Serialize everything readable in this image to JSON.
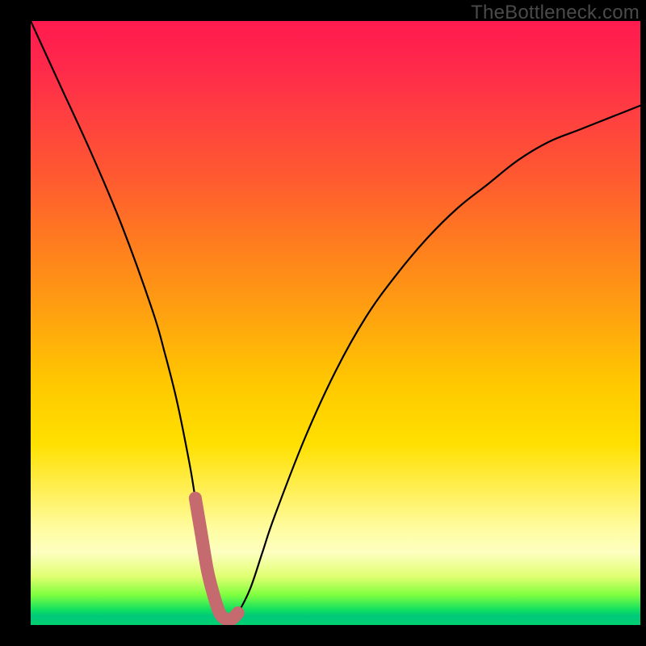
{
  "watermark": {
    "text": "TheBottleneck.com"
  },
  "chart_data": {
    "type": "line",
    "title": "",
    "xlabel": "",
    "ylabel": "",
    "xlim": [
      0,
      100
    ],
    "ylim": [
      0,
      100
    ],
    "x": [
      0,
      5,
      10,
      15,
      20,
      22,
      24,
      26,
      27,
      28,
      29,
      30,
      31,
      32,
      33,
      34,
      36,
      38,
      40,
      45,
      50,
      55,
      60,
      65,
      70,
      75,
      80,
      85,
      90,
      95,
      100
    ],
    "values": [
      100,
      89,
      78,
      66,
      52,
      45,
      37,
      27,
      21,
      15,
      9,
      5,
      2,
      1,
      1,
      2,
      6,
      12,
      18,
      31,
      42,
      51,
      58,
      64,
      69,
      73,
      77,
      80,
      82,
      84,
      86
    ],
    "highlight_range_x": [
      27,
      35
    ],
    "highlight_threshold_y": 15
  },
  "colors": {
    "curve": "#000000",
    "highlight": "#c56a6e"
  }
}
